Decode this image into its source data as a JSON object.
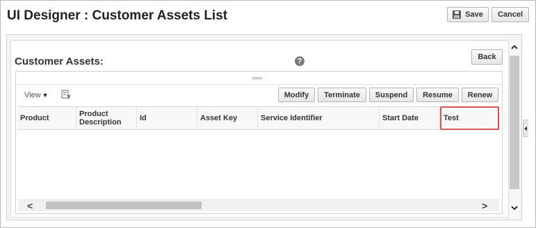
{
  "page": {
    "title": "UI Designer : Customer Assets List",
    "save_label": "Save",
    "cancel_label": "Cancel"
  },
  "panel": {
    "section_title": "Customer Assets:",
    "help_glyph": "?",
    "back_label": "Back"
  },
  "toolbar": {
    "view_label": "View",
    "view_caret": "▼",
    "actions": [
      "Modify",
      "Terminate",
      "Suspend",
      "Resume",
      "Renew"
    ]
  },
  "table": {
    "columns": [
      "Product",
      "Product Description",
      "Id",
      "Asset Key",
      "Service Identifier",
      "Start Date",
      "Test"
    ],
    "highlighted_column": "Test",
    "highlight_color": "#d9534f"
  },
  "scroll": {
    "left_arrow": "<",
    "right_arrow": ">",
    "up_arrow": "^",
    "down_arrow": "v"
  },
  "icons": [
    "save-icon",
    "help-icon",
    "filter-icon",
    "chevron-left-icon",
    "chevron-right-icon",
    "chevron-up-icon",
    "chevron-down-icon",
    "collapse-arrow-icon"
  ]
}
